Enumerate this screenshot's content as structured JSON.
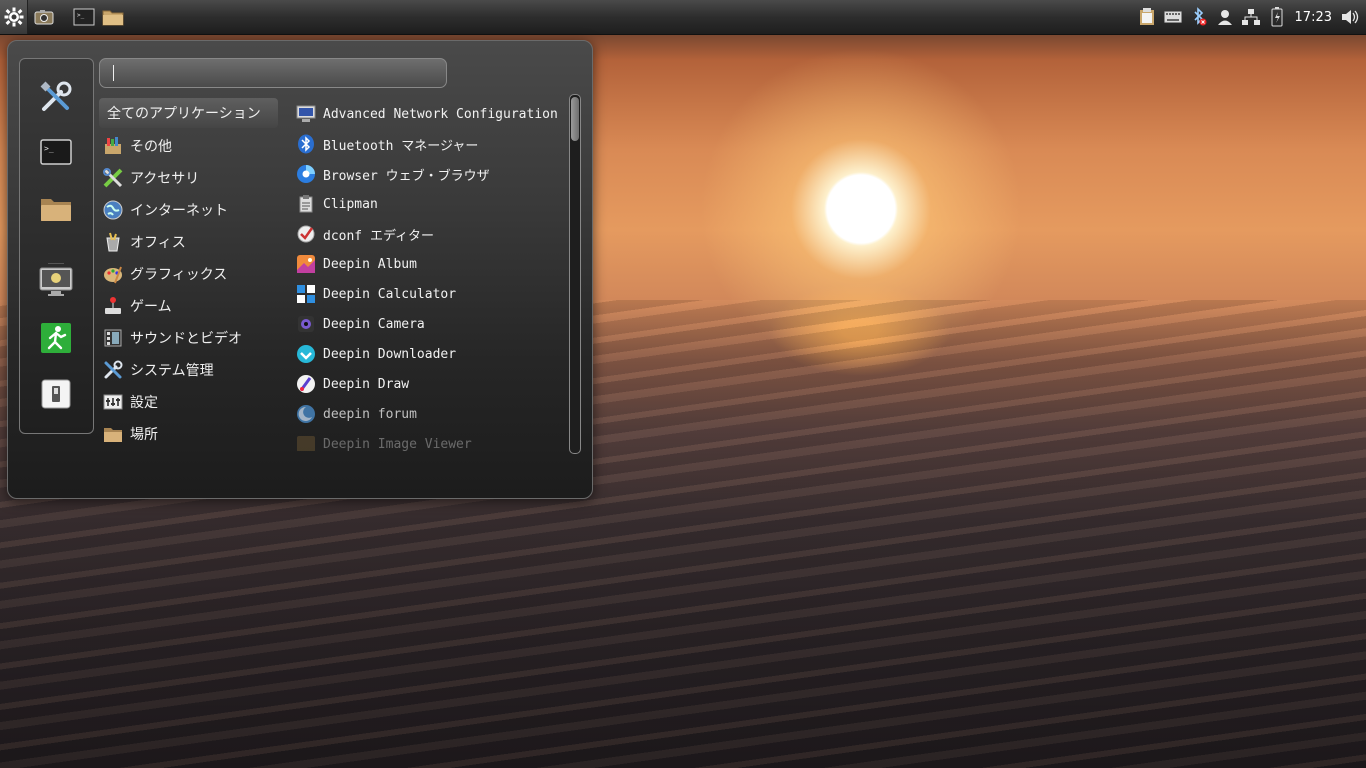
{
  "panel": {
    "launchers": [
      {
        "name": "menu-gear-icon"
      },
      {
        "name": "screenshot-icon"
      },
      {
        "name": "terminal-icon"
      },
      {
        "name": "file-manager-icon"
      }
    ],
    "tray_icons": [
      "clipboard-icon",
      "keyboard-icon",
      "bluetooth-off-icon",
      "user-icon",
      "network-icon",
      "battery-icon"
    ],
    "clock": "17:23",
    "volume_icon": "volume-icon"
  },
  "menu": {
    "search": {
      "value": "",
      "placeholder": ""
    },
    "favorites": [
      "settings-manager-icon",
      "terminal-icon",
      "folder-icon",
      "lock-screen-icon",
      "logout-icon",
      "switch-user-icon"
    ],
    "categories": [
      {
        "label": "全てのアプリケーション",
        "icon": "",
        "selected": true
      },
      {
        "label": "その他",
        "icon": "other-icon"
      },
      {
        "label": "アクセサリ",
        "icon": "accessories-icon"
      },
      {
        "label": "インターネット",
        "icon": "internet-icon"
      },
      {
        "label": "オフィス",
        "icon": "office-icon"
      },
      {
        "label": "グラフィックス",
        "icon": "graphics-icon"
      },
      {
        "label": "ゲーム",
        "icon": "games-icon"
      },
      {
        "label": "サウンドとビデオ",
        "icon": "multimedia-icon"
      },
      {
        "label": "システム管理",
        "icon": "system-icon"
      },
      {
        "label": "設定",
        "icon": "settings-icon"
      },
      {
        "label": "場所",
        "icon": "places-icon"
      }
    ],
    "apps": [
      {
        "label": "Advanced Network Configuration",
        "icon": "network-config-icon"
      },
      {
        "label": "Bluetooth マネージャー",
        "icon": "bluetooth-icon"
      },
      {
        "label": "Browser ウェブ・ブラウザ",
        "icon": "browser-icon"
      },
      {
        "label": "Clipman",
        "icon": "clipman-icon"
      },
      {
        "label": "dconf エディター",
        "icon": "dconf-icon"
      },
      {
        "label": "Deepin Album",
        "icon": "album-icon"
      },
      {
        "label": "Deepin Calculator",
        "icon": "calculator-icon"
      },
      {
        "label": "Deepin Camera",
        "icon": "camera-icon"
      },
      {
        "label": "Deepin Downloader",
        "icon": "downloader-icon"
      },
      {
        "label": "Deepin Draw",
        "icon": "draw-icon"
      },
      {
        "label": "deepin forum",
        "icon": "forum-icon"
      },
      {
        "label": "Deepin Image Viewer",
        "icon": "image-viewer-icon"
      }
    ]
  },
  "colors": {
    "panel": "#2d2d2d",
    "menu_bg": "#2a2a2a",
    "text": "#f0f0f0"
  }
}
